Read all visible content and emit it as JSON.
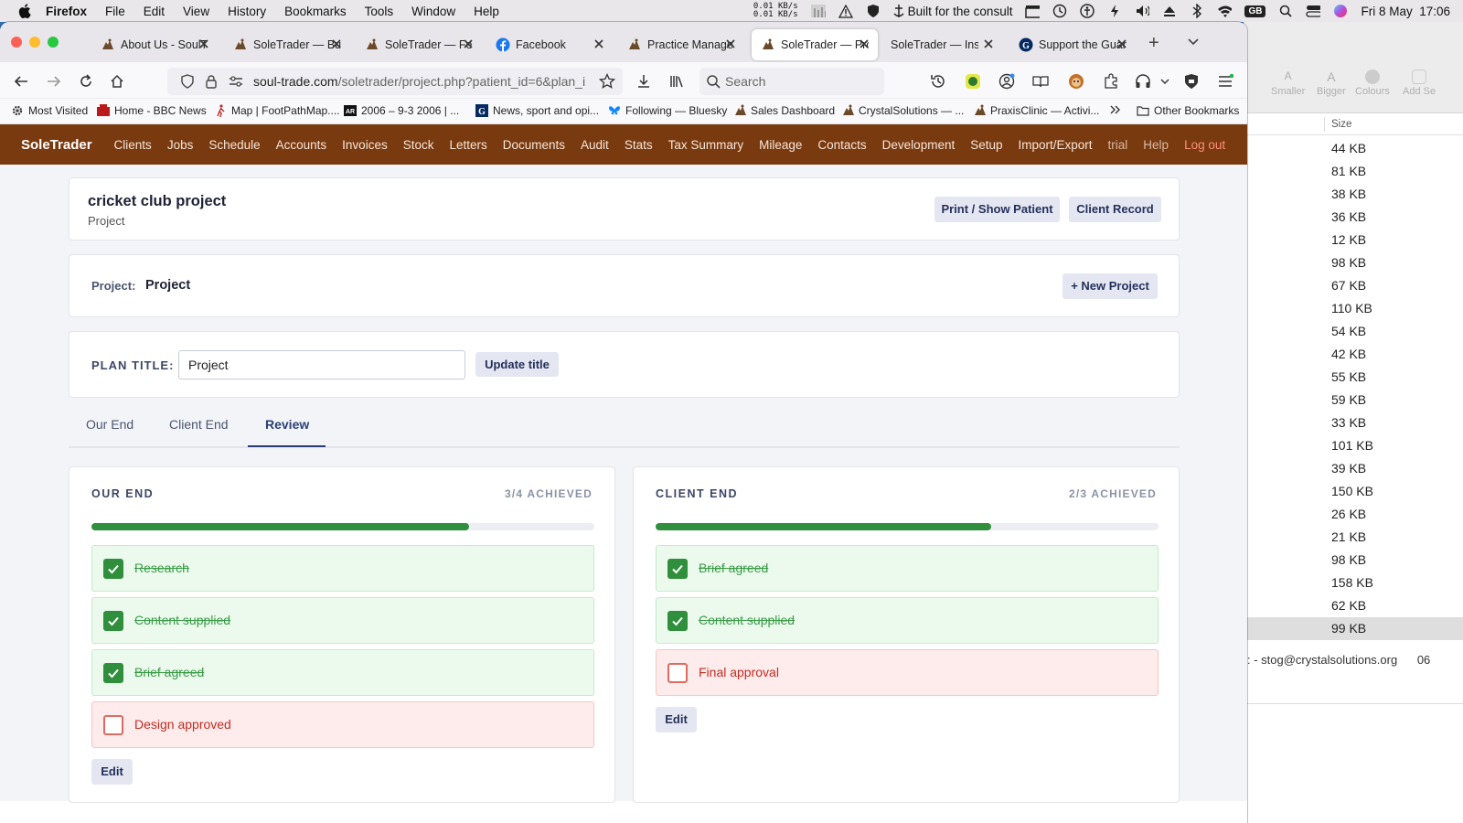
{
  "menubar": {
    "app": "Firefox",
    "items": [
      "File",
      "Edit",
      "View",
      "History",
      "Bookmarks",
      "Tools",
      "Window",
      "Help"
    ],
    "net_up": "0.01 KB/s",
    "net_down": "0.01 KB/s",
    "status_text": "Built for the consult",
    "input_source": "GB",
    "datetime": "Fri 8 May  17:06"
  },
  "finder": {
    "toolbar": [
      "Smaller",
      "Bigger",
      "Colours",
      "Add Se"
    ],
    "size_header": "Size",
    "sizes": [
      "44 KB",
      "81 KB",
      "38 KB",
      "36 KB",
      "12 KB",
      "98 KB",
      "67 KB",
      "110 KB",
      "54 KB",
      "42 KB",
      "55 KB",
      "59 KB",
      "33 KB",
      "101 KB",
      "39 KB",
      "150 KB",
      "26 KB",
      "21 KB",
      "98 KB",
      "158 KB",
      "62 KB",
      "99 KB"
    ],
    "selected_index": 21,
    "footer_text": ": - stog@crystalsolutions.org",
    "footer_num": "06"
  },
  "browser": {
    "tabs": [
      {
        "label": "About Us - SoulT",
        "icon": "soletrader-icon",
        "active": false
      },
      {
        "label": "SoleTrader — Bu",
        "icon": "soletrader-icon",
        "active": false
      },
      {
        "label": "SoleTrader — Fe",
        "icon": "soletrader-icon",
        "active": false
      },
      {
        "label": "Facebook",
        "icon": "facebook-icon",
        "active": false
      },
      {
        "label": "Practice Manage",
        "icon": "soletrader-icon",
        "active": false
      },
      {
        "label": "SoleTrader — Pro",
        "icon": "soletrader-icon",
        "active": true
      },
      {
        "label": "SoleTrader — Installa",
        "icon": "none",
        "active": false
      },
      {
        "label": "Support the Guar",
        "icon": "guardian-icon",
        "active": false
      }
    ],
    "url_host": "soul-trade.com",
    "url_path": "/soletrader/project.php?patient_id=6&plan_i",
    "search_placeholder": "Search",
    "bookmarks": [
      {
        "label": "Most Visited",
        "icon": "gear-icon"
      },
      {
        "label": "Home - BBC News",
        "icon": "bbc-icon"
      },
      {
        "label": "Map | FootPathMap....",
        "icon": "hiker-icon"
      },
      {
        "label": "2006 – 9-3 2006 | ...",
        "icon": "news-icon"
      },
      {
        "label": "News, sport and opi...",
        "icon": "guardian-g-icon"
      },
      {
        "label": "Following — Bluesky",
        "icon": "bluesky-icon"
      },
      {
        "label": "Sales Dashboard",
        "icon": "soletrader-icon"
      },
      {
        "label": "CrystalSolutions — ...",
        "icon": "soletrader-icon"
      },
      {
        "label": "PraxisClinic — Activi...",
        "icon": "soletrader-icon"
      }
    ],
    "other_bookmarks": "Other Bookmarks"
  },
  "app": {
    "brand": "SoleTrader",
    "nav": [
      "Clients",
      "Jobs",
      "Schedule",
      "Accounts",
      "Invoices",
      "Stock",
      "Letters",
      "Documents",
      "Audit",
      "Stats",
      "Tax Summary",
      "Mileage",
      "Contacts",
      "Development",
      "Setup",
      "Import/Export"
    ],
    "nav_trial": "trial",
    "nav_help": "Help",
    "nav_logout": "Log out",
    "header": {
      "title": "cricket club project",
      "subtitle": "Project",
      "print_button": "Print / Show Patient",
      "client_record_button": "Client Record"
    },
    "project_row": {
      "label": "Project:",
      "name": "Project",
      "new_button": "+ New Project"
    },
    "plan": {
      "label": "PLAN TITLE:",
      "value": "Project",
      "update_button": "Update title"
    },
    "tabs": [
      {
        "label": "Our End",
        "active": false
      },
      {
        "label": "Client End",
        "active": false
      },
      {
        "label": "Review",
        "active": true
      }
    ],
    "panels": [
      {
        "title": "OUR END",
        "count": "3/4 ACHIEVED",
        "progress": 0.75,
        "items": [
          {
            "label": "Research",
            "done": true
          },
          {
            "label": "Content supplied",
            "done": true
          },
          {
            "label": "Brief agreed",
            "done": true
          },
          {
            "label": "Design approved",
            "done": false
          }
        ],
        "edit": "Edit"
      },
      {
        "title": "CLIENT END",
        "count": "2/3 ACHIEVED",
        "progress": 0.6667,
        "items": [
          {
            "label": "Brief agreed",
            "done": true
          },
          {
            "label": "Content supplied",
            "done": true
          },
          {
            "label": "Final approval",
            "done": false
          }
        ],
        "edit": "Edit"
      }
    ]
  },
  "colors": {
    "nav_bg": "#7a3a10",
    "done_green": "#2f8f3c",
    "todo_red": "#c42b23",
    "button_bg": "#e4e7f2",
    "tab_active": "#2a3f7a"
  }
}
